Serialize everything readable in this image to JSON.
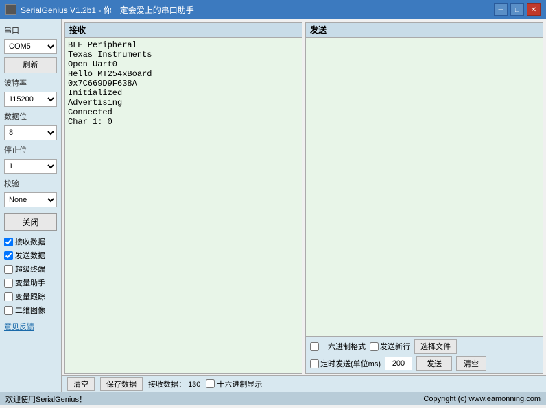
{
  "window": {
    "title": "SerialGenius V1.2b1 - 你一定会爱上的串口助手",
    "icon": "■"
  },
  "window_controls": {
    "minimize": "─",
    "maximize": "□",
    "close": "✕"
  },
  "sidebar": {
    "port_label": "串口",
    "port_value": "COM5",
    "port_options": [
      "COM5"
    ],
    "refresh_btn": "刷新",
    "baud_label": "波特率",
    "baud_value": "115200",
    "baud_options": [
      "115200"
    ],
    "databits_label": "数据位",
    "databits_value": "8",
    "databits_options": [
      "8"
    ],
    "stopbits_label": "停止位",
    "stopbits_value": "1",
    "stopbits_options": [
      "1"
    ],
    "parity_label": "校验",
    "parity_value": "None",
    "parity_options": [
      "None"
    ],
    "close_btn": "关闭",
    "checkboxes": [
      {
        "label": "接收数据",
        "checked": true
      },
      {
        "label": "发送数据",
        "checked": true
      },
      {
        "label": "超级终端",
        "checked": false
      },
      {
        "label": "变量助手",
        "checked": false
      },
      {
        "label": "变量跟踪",
        "checked": false
      },
      {
        "label": "二维图像",
        "checked": false
      }
    ],
    "feedback_link": "意见反馈"
  },
  "receive_panel": {
    "header": "接收",
    "content": "BLE Peripheral\nTexas Instruments\nOpen Uart0\nHello MT254xBoard\n0x7C669D9F638A\nInitialized\nAdvertising\nConnected\nChar 1: 0\n"
  },
  "send_panel": {
    "header": "发送",
    "content": ""
  },
  "send_bottom": {
    "hex_mode_label": "十六进制格式",
    "newline_label": "发送新行",
    "select_file_btn": "选择文件",
    "timed_label": "定时发送(单位ms)",
    "timed_value": "200",
    "send_btn": "发送",
    "clear_btn": "清空"
  },
  "bottom_toolbar": {
    "clear_btn": "清空",
    "save_btn": "保存数据",
    "rx_count_label": "接收数据：",
    "rx_count": "130",
    "hex_display_label": "十六进制显示"
  },
  "status_bar": {
    "welcome": "欢迎使用SerialGenius！",
    "copyright": "Copyright (c) www.eamonning.com"
  }
}
